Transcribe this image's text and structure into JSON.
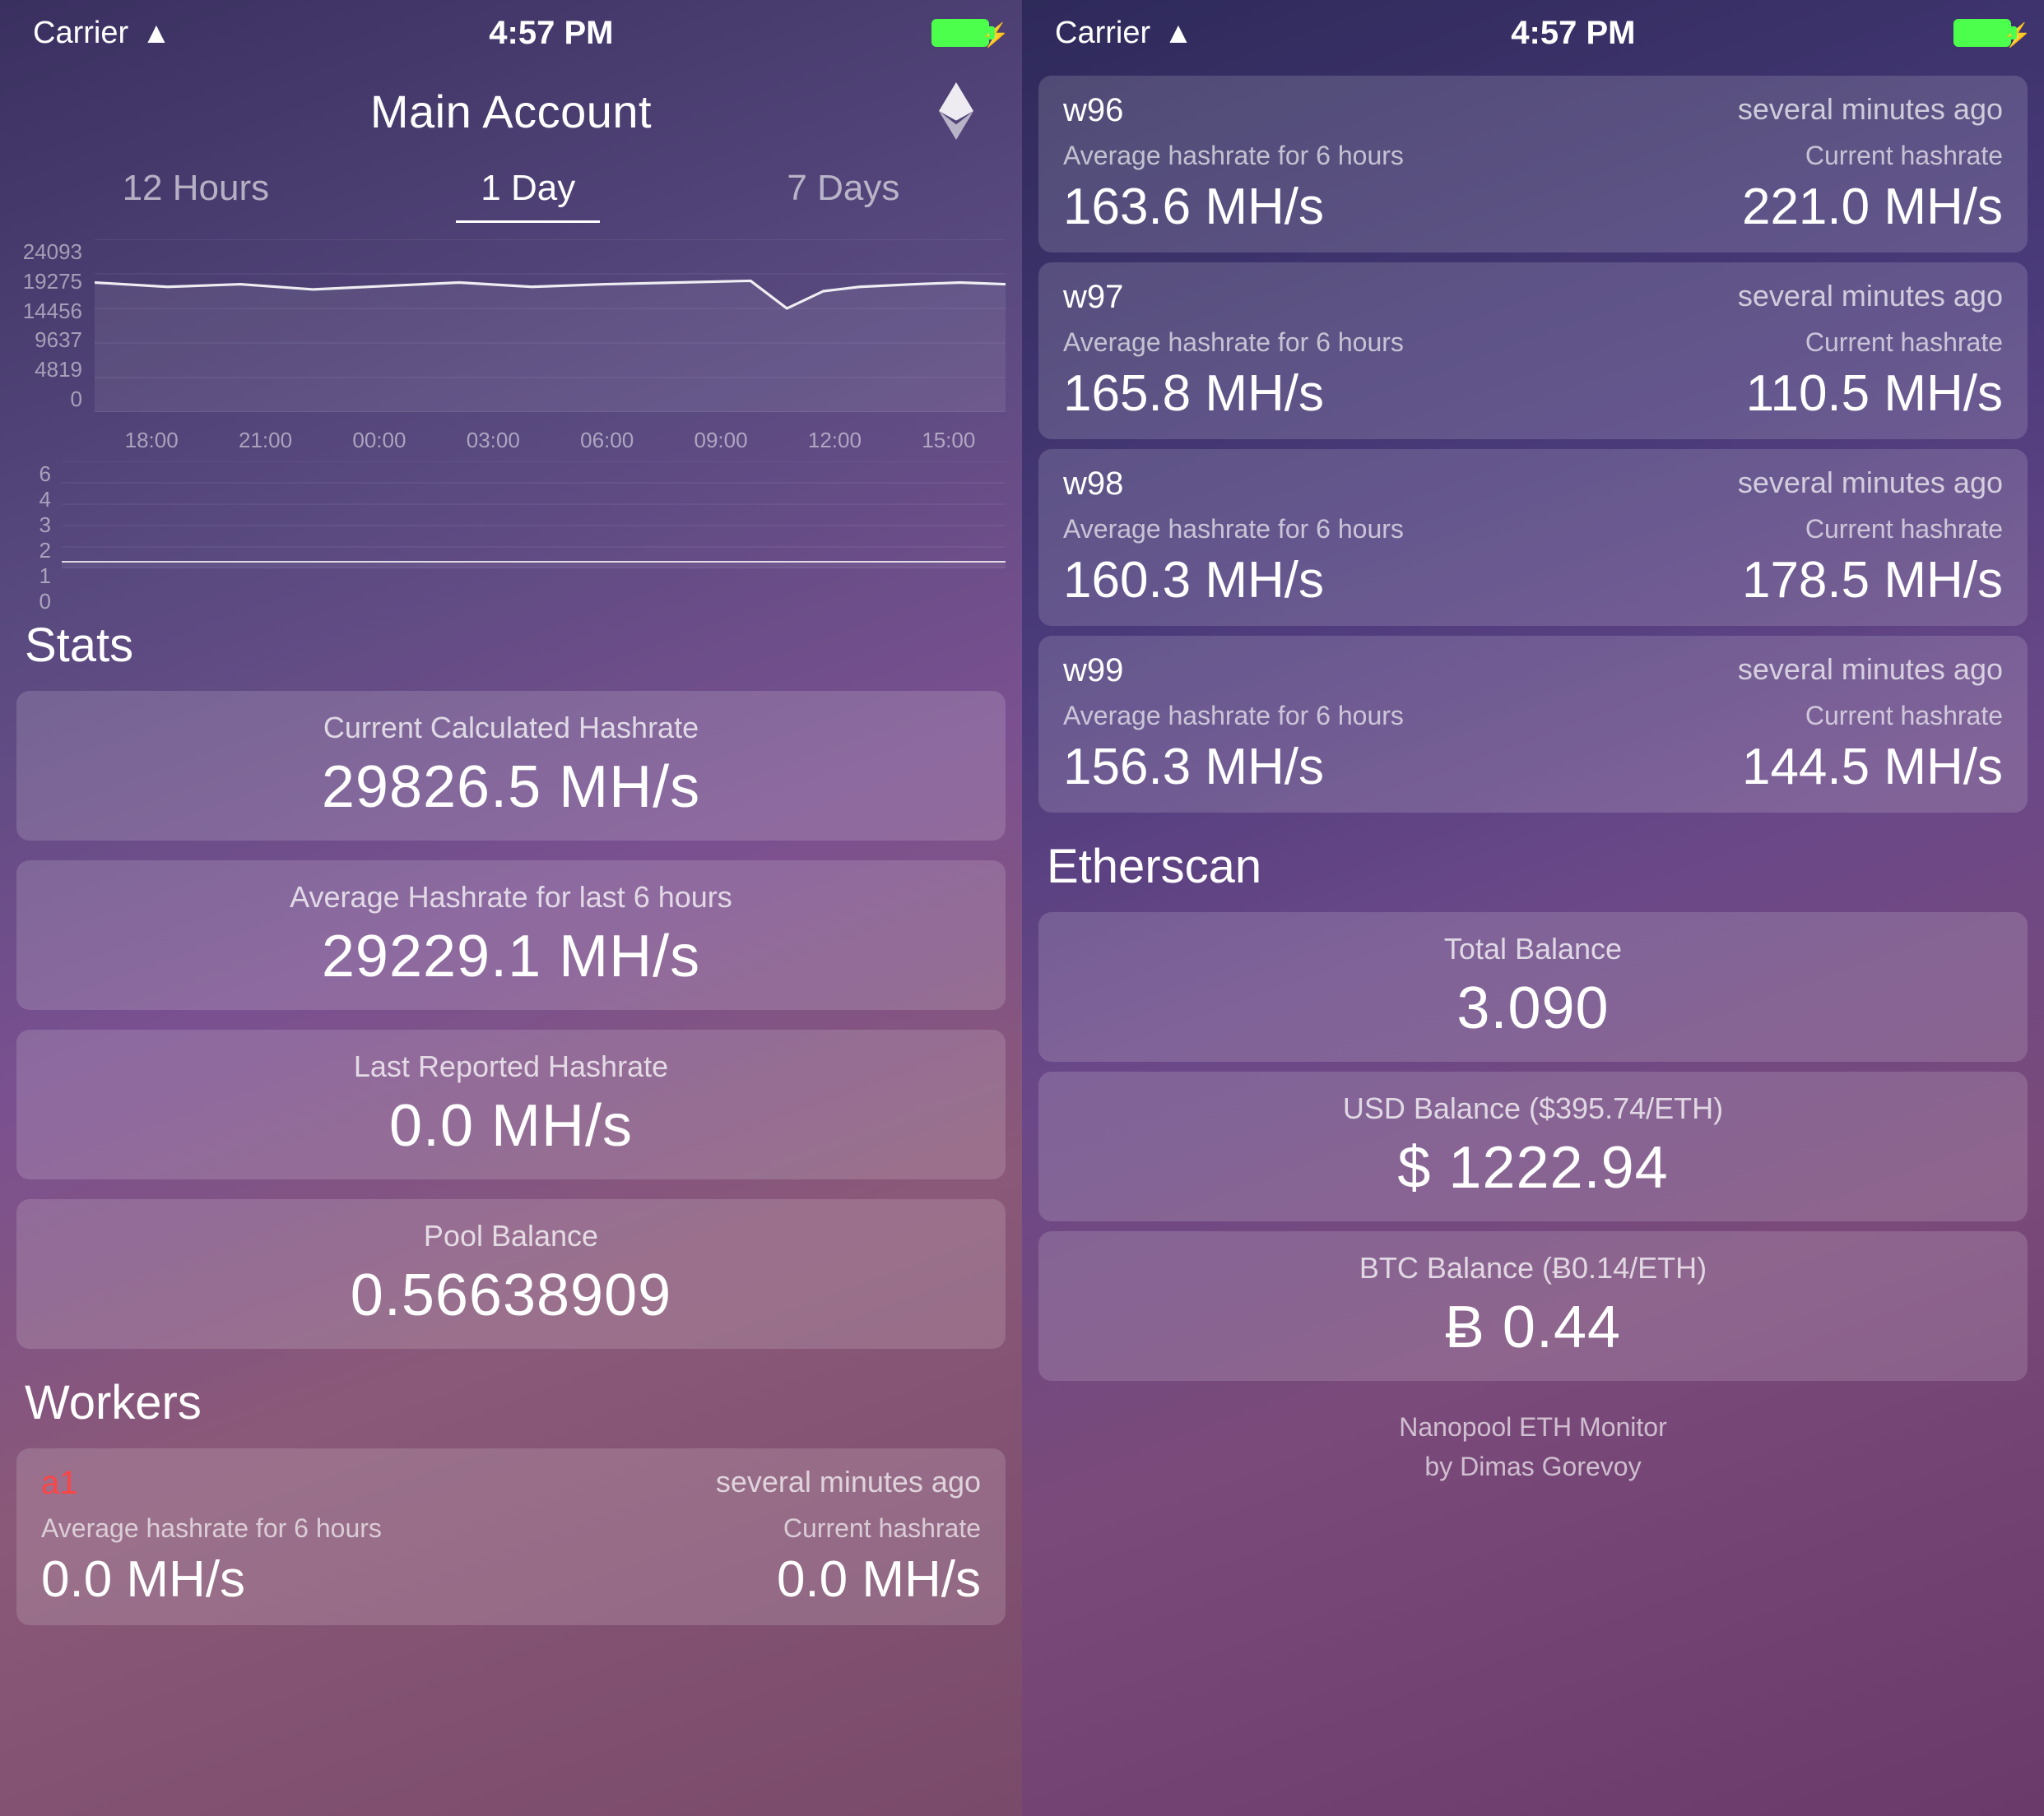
{
  "left": {
    "status": {
      "carrier": "Carrier",
      "time": "4:57 PM",
      "wifi": true
    },
    "header": {
      "title": "Main Account"
    },
    "tabs": [
      {
        "label": "12 Hours",
        "active": false
      },
      {
        "label": "1 Day",
        "active": true
      },
      {
        "label": "7 Days",
        "active": false
      }
    ],
    "chart": {
      "y_labels": [
        "24093",
        "19275",
        "14456",
        "9637",
        "4819",
        "0"
      ],
      "x_labels": [
        "18:00",
        "21:00",
        "00:00",
        "03:00",
        "06:00",
        "09:00",
        "12:00",
        "15:00"
      ],
      "y2_labels": [
        "6",
        "4",
        "3",
        "2",
        "1",
        "0"
      ]
    },
    "stats_label": "Stats",
    "stats": [
      {
        "label": "Current Calculated Hashrate",
        "value": "29826.5 MH/s"
      },
      {
        "label": "Average Hashrate for last 6 hours",
        "value": "29229.1 MH/s"
      },
      {
        "label": "Last Reported Hashrate",
        "value": "0.0 MH/s"
      },
      {
        "label": "Pool Balance",
        "value": "0.56638909"
      }
    ],
    "workers_label": "Workers",
    "workers": [
      {
        "name": "a1",
        "alert": true,
        "time": "several minutes ago",
        "avg_label": "Average hashrate for 6 hours",
        "avg_value": "0.0 MH/s",
        "cur_label": "Current hashrate",
        "cur_value": "0.0 MH/s"
      }
    ]
  },
  "right": {
    "status": {
      "carrier": "Carrier",
      "time": "4:57 PM",
      "wifi": true
    },
    "workers": [
      {
        "name": "w96",
        "alert": false,
        "time": "several minutes ago",
        "avg_label": "Average hashrate for 6 hours",
        "avg_value": "163.6 MH/s",
        "cur_label": "Current hashrate",
        "cur_value": "221.0 MH/s"
      },
      {
        "name": "w97",
        "alert": false,
        "time": "several minutes ago",
        "avg_label": "Average hashrate for 6 hours",
        "avg_value": "165.8 MH/s",
        "cur_label": "Current hashrate",
        "cur_value": "110.5 MH/s"
      },
      {
        "name": "w98",
        "alert": false,
        "time": "several minutes ago",
        "avg_label": "Average hashrate for 6 hours",
        "avg_value": "160.3 MH/s",
        "cur_label": "Current hashrate",
        "cur_value": "178.5 MH/s"
      },
      {
        "name": "w99",
        "alert": false,
        "time": "several minutes ago",
        "avg_label": "Average hashrate for 6 hours",
        "avg_value": "156.3 MH/s",
        "cur_label": "Current hashrate",
        "cur_value": "144.5 MH/s"
      }
    ],
    "workers_section_label": "Workers",
    "etherscan_label": "Etherscan",
    "etherscan": [
      {
        "label": "Total Balance",
        "value": "3.090"
      },
      {
        "label": "USD Balance  ($395.74/ETH)",
        "value": "$ 1222.94"
      },
      {
        "label": "BTC Balance  (Ƀ0.14/ETH)",
        "value": "Ƀ 0.44"
      }
    ],
    "footer": "Nanopool ETH Monitor\nby Dimas Gorevoy"
  }
}
